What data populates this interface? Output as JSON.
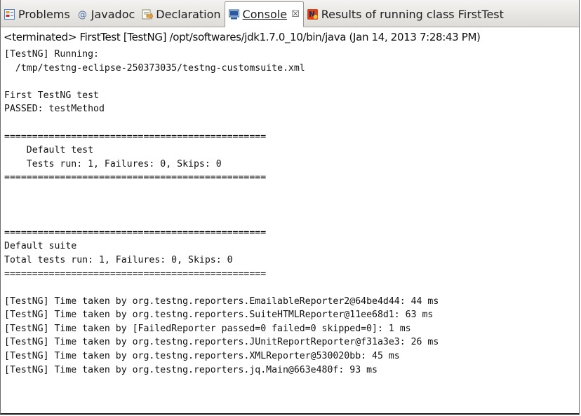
{
  "tabs": [
    {
      "label": "Problems",
      "icon": "problems-icon",
      "active": false
    },
    {
      "label": "Javadoc",
      "icon": "javadoc-at-icon",
      "active": false
    },
    {
      "label": "Declaration",
      "icon": "declaration-icon",
      "active": false
    },
    {
      "label": "Console",
      "icon": "console-icon",
      "active": true,
      "close_glyph": "☒"
    },
    {
      "label": "Results of running class FirstTest",
      "icon": "testng-icon",
      "active": false
    }
  ],
  "status_line": "<terminated> FirstTest [TestNG] /opt/softwares/jdk1.7.0_10/bin/java (Jan 14, 2013 7:28:43 PM)",
  "console_lines": [
    "[TestNG] Running:",
    "  /tmp/testng-eclipse-250373035/testng-customsuite.xml",
    "",
    "First TestNG test",
    "PASSED: testMethod",
    "",
    "===============================================",
    "    Default test",
    "    Tests run: 1, Failures: 0, Skips: 0",
    "===============================================",
    "",
    "",
    "",
    "===============================================",
    "Default suite",
    "Total tests run: 1, Failures: 0, Skips: 0",
    "===============================================",
    "",
    "[TestNG] Time taken by org.testng.reporters.EmailableReporter2@64be4d44: 44 ms",
    "[TestNG] Time taken by org.testng.reporters.SuiteHTMLReporter@11ee68d1: 63 ms",
    "[TestNG] Time taken by [FailedReporter passed=0 failed=0 skipped=0]: 1 ms",
    "[TestNG] Time taken by org.testng.reporters.JUnitReportReporter@f31a3e3: 26 ms",
    "[TestNG] Time taken by org.testng.reporters.XMLReporter@530020bb: 45 ms",
    "[TestNG] Time taken by org.testng.reporters.jq.Main@663e480f: 93 ms"
  ],
  "colors": {
    "tab_bar": "#dedcd8",
    "console_text": "#111111",
    "console_icon": "#2c5aa0",
    "testng_icon": "#d9431b"
  }
}
